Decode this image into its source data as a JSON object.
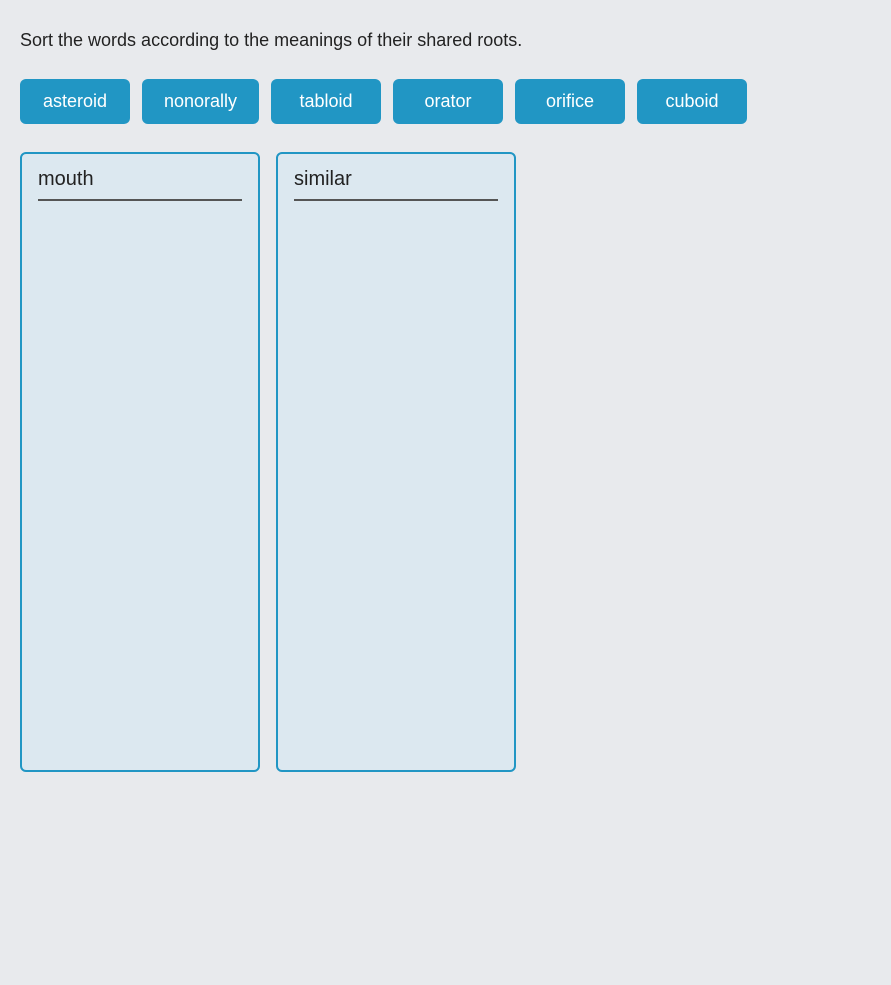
{
  "instruction": "Sort the words according to the meanings of their shared roots.",
  "word_bank": {
    "tiles": [
      {
        "id": "asteroid",
        "label": "asteroid"
      },
      {
        "id": "nonorally",
        "label": "nonorally"
      },
      {
        "id": "tabloid",
        "label": "tabloid"
      },
      {
        "id": "orator",
        "label": "orator"
      },
      {
        "id": "orifice",
        "label": "orifice"
      },
      {
        "id": "cuboid",
        "label": "cuboid"
      }
    ]
  },
  "drop_zones": [
    {
      "id": "mouth",
      "header": "mouth"
    },
    {
      "id": "similar",
      "header": "similar"
    }
  ]
}
